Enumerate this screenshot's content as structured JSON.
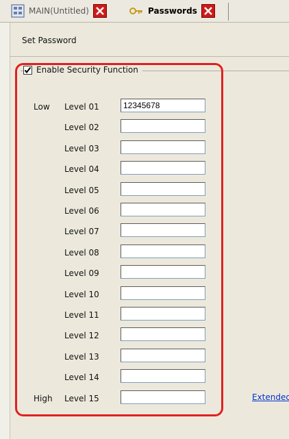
{
  "tabs": [
    {
      "label": "MAIN(Untitled)",
      "icon": "screen-icon"
    },
    {
      "label": "Passwords",
      "icon": "key-icon"
    }
  ],
  "panel": {
    "heading": "Set Password",
    "security": {
      "label": "Enable Security Function",
      "checked": true
    }
  },
  "levels": [
    {
      "label": "Level 01",
      "value": "12345678"
    },
    {
      "label": "Level 02",
      "value": ""
    },
    {
      "label": "Level 03",
      "value": ""
    },
    {
      "label": "Level 04",
      "value": ""
    },
    {
      "label": "Level 05",
      "value": ""
    },
    {
      "label": "Level 06",
      "value": ""
    },
    {
      "label": "Level 07",
      "value": ""
    },
    {
      "label": "Level 08",
      "value": ""
    },
    {
      "label": "Level 09",
      "value": ""
    },
    {
      "label": "Level 10",
      "value": ""
    },
    {
      "label": "Level 11",
      "value": ""
    },
    {
      "label": "Level 12",
      "value": ""
    },
    {
      "label": "Level 13",
      "value": ""
    },
    {
      "label": "Level 14",
      "value": ""
    },
    {
      "label": "Level 15",
      "value": ""
    }
  ],
  "side_labels": {
    "low": "Low",
    "high": "High"
  },
  "extended_link": "Extended",
  "colors": {
    "highlight": "#e02020",
    "close": "#cc1b1b",
    "link": "#0033cc"
  }
}
